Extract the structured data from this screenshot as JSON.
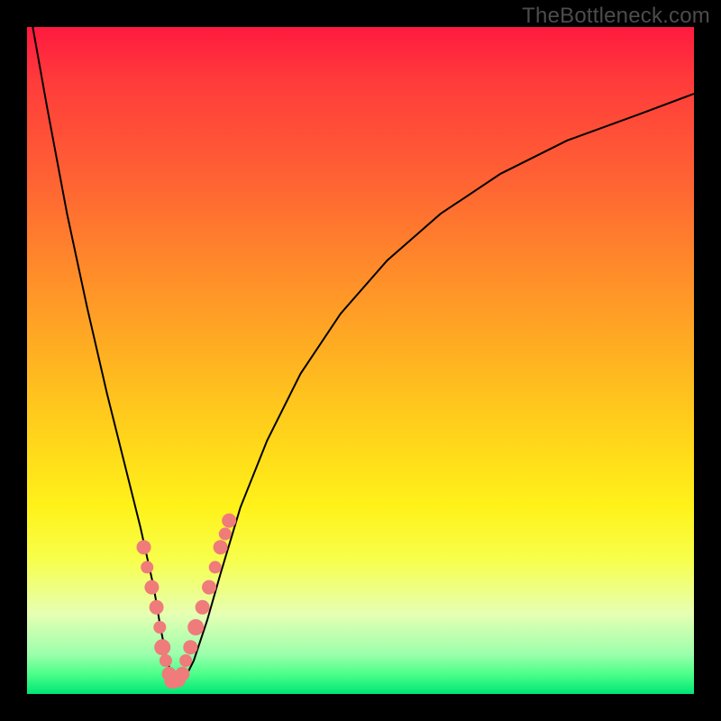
{
  "watermark": "TheBottleneck.com",
  "colors": {
    "frame": "#000000",
    "line": "#000000",
    "points": "#ef7b7b",
    "gradient_stops": [
      "#ff1a3f",
      "#ff3b3b",
      "#ff6034",
      "#ff8a2a",
      "#ffb321",
      "#ffd61a",
      "#fff21a",
      "#f7ff4d",
      "#e6ffb3",
      "#9cffac",
      "#4cff8a",
      "#00e676"
    ]
  },
  "chart_data": {
    "type": "line",
    "title": "",
    "xlabel": "",
    "ylabel": "",
    "xlim": [
      0,
      100
    ],
    "ylim": [
      0,
      100
    ],
    "grid": false,
    "series": [
      {
        "name": "bottleneck-curve",
        "x": [
          0.5,
          3,
          6,
          9,
          12,
          15,
          17,
          19,
          20,
          21,
          22,
          23,
          24,
          25,
          27,
          29,
          32,
          36,
          41,
          47,
          54,
          62,
          71,
          81,
          92,
          100
        ],
        "y": [
          102,
          88,
          72,
          58,
          45,
          33,
          25,
          16,
          10,
          5,
          2,
          2,
          3,
          5,
          11,
          18,
          28,
          38,
          48,
          57,
          65,
          72,
          78,
          83,
          87,
          90
        ]
      }
    ],
    "points": {
      "name": "highlighted-points",
      "x": [
        17.5,
        18.0,
        18.7,
        19.4,
        19.9,
        20.3,
        20.8,
        21.3,
        21.8,
        22.3,
        22.8,
        23.3,
        23.8,
        24.5,
        25.3,
        26.3,
        27.3,
        28.2,
        29.0,
        29.7,
        30.3
      ],
      "y": [
        22,
        19,
        16,
        13,
        10,
        7,
        5,
        3,
        2,
        2,
        2,
        3,
        5,
        7,
        10,
        13,
        16,
        19,
        22,
        24,
        26
      ],
      "r": [
        8,
        7,
        8,
        8,
        7,
        9,
        7,
        8,
        9,
        8,
        7,
        8,
        7,
        8,
        9,
        8,
        8,
        7,
        8,
        7,
        8
      ]
    }
  }
}
